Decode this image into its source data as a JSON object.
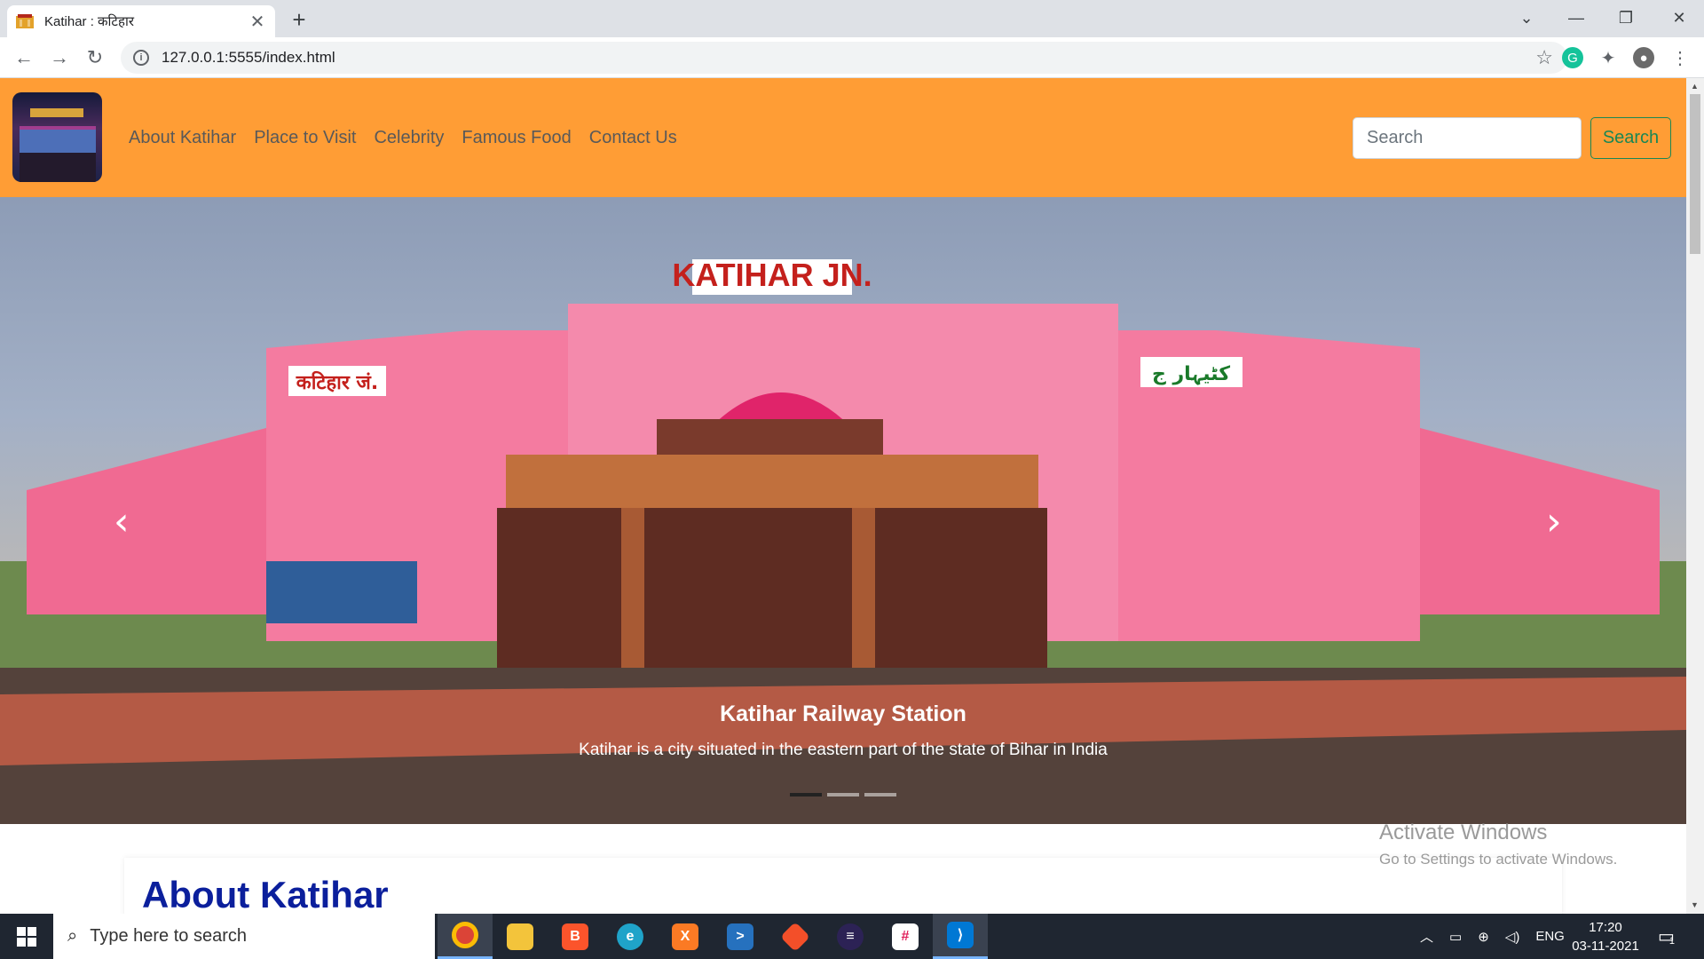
{
  "browser": {
    "tab_title": "Katihar : कटिहार",
    "tab_close": "✕",
    "new_tab": "+",
    "url": "127.0.0.1:5555/index.html",
    "window_controls": {
      "dropdown": "⌄",
      "minimize": "—",
      "restore": "❐",
      "close": "✕"
    },
    "nav": {
      "back": "←",
      "forward": "→",
      "reload": "↻"
    },
    "star": "☆",
    "extensions": [
      "grammarly-icon",
      "puzzle-icon",
      "profile-avatar"
    ],
    "menu": "⋮"
  },
  "navbar": {
    "links": [
      "About Katihar",
      "Place to Visit",
      "Celebrity",
      "Famous Food",
      "Contact Us"
    ],
    "search_placeholder": "Search",
    "search_button": "Search"
  },
  "carousel": {
    "caption_title": "Katihar Railway Station",
    "caption_text": "Katihar is a city situated in the eastern part of the state of Bihar in India",
    "sign_main": "KATIHAR JN.",
    "sign_hindi": "कटिहार जं.",
    "sign_urdu": "کٹیہار ج",
    "prev": "‹",
    "next": "›",
    "indicators": 3,
    "active_indicator": 0
  },
  "about": {
    "title": "About Katihar"
  },
  "watermark": {
    "line1": "Activate Windows",
    "line2": "Go to Settings to activate Windows."
  },
  "taskbar": {
    "search_placeholder": "Type here to search",
    "pinned": [
      "chrome-icon",
      "file-explorer-icon",
      "brave-icon",
      "edge-icon",
      "xampp-icon",
      "powershell-icon",
      "git-icon",
      "eclipse-icon",
      "slack-icon",
      "vscode-icon"
    ],
    "tray_lang": "ENG",
    "time": "17:20",
    "date": "03-11-2021",
    "notification_count": "1"
  },
  "colors": {
    "navbar": "#ff9d35",
    "accent_green": "#198754",
    "about_title": "#0b1f9c"
  }
}
